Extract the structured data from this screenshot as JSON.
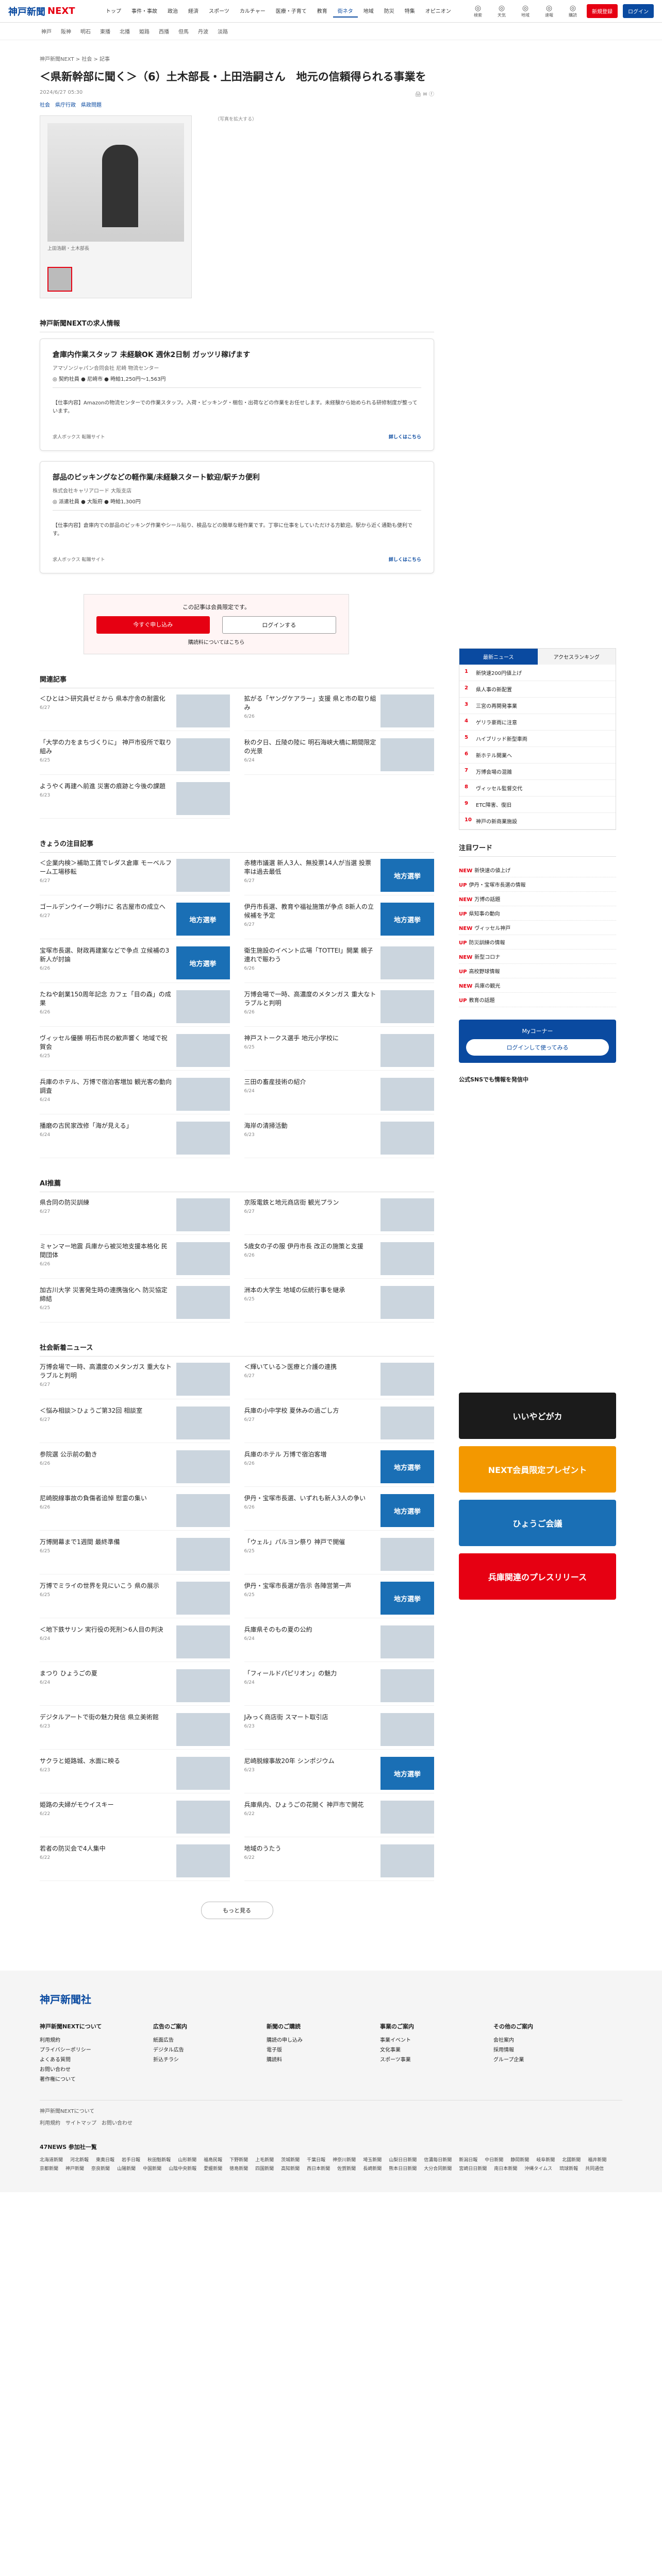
{
  "header": {
    "logo": "神戸新聞",
    "logo_next": "NEXT",
    "nav": [
      "トップ",
      "事件・事故",
      "政治",
      "経済",
      "スポーツ",
      "カルチャー",
      "医療・子育て",
      "教育",
      "街ネタ",
      "地域",
      "防災",
      "特集",
      "オピニオン"
    ],
    "icons": [
      "検索",
      "天気",
      "地域",
      "速報",
      "購読"
    ],
    "register": "新規登録",
    "login": "ログイン"
  },
  "subnav": [
    "神戸",
    "阪神",
    "明石",
    "東播",
    "北播",
    "姫路",
    "西播",
    "但馬",
    "丹波",
    "淡路"
  ],
  "breadcrumb": "神戸新聞NEXT > 社会 > 記事",
  "article": {
    "title": "＜県新幹部に聞く＞（6）土木部長・上田浩嗣さん　地元の信頼得られる事業を",
    "date": "2024/6/27 05:30",
    "tags": "社会　県庁行政　県政問題",
    "caption": "上田浩嗣・土木部長",
    "footnote": "（写真を拡大する）"
  },
  "jobs_head": "神戸新聞NEXTの求人情報",
  "jobs": [
    {
      "title": "倉庫内作業スタッフ 未経験OK 週休2日制 ガッツリ稼げます",
      "company": "アマゾンジャパン合同会社 尼崎 物流センター",
      "detail": "◎ 契約社員 ● 尼崎市 ● 時給1,250円～1,563円",
      "desc": "【仕事内容】Amazonの物流センターでの作業スタッフ。入荷・ピッキング・梱包・出荷などの作業をお任せします。未経験から始められる研修制度が整っています。",
      "source": "求人ボックス 転職サイト",
      "more": "詳しくはこちら"
    },
    {
      "title": "部品のピッキングなどの軽作業/未経験スタート歓迎/駅チカ便利",
      "company": "株式会社キャリアロード 大阪支店",
      "detail": "◎ 派遣社員 ● 大阪府 ● 時給1,300円",
      "desc": "【仕事内容】倉庫内での部品のピッキング作業やシール貼り、検品などの簡単な軽作業です。丁寧に仕事をしていただける方歓迎。駅から近く通勤も便利です。",
      "source": "求人ボックス 転職サイト",
      "more": "詳しくはこちら"
    }
  ],
  "premium": {
    "text": "この記事は会員限定です。",
    "btn1": "今すぐ申し込み",
    "btn2": "ログインする",
    "link": "購読料についてはこちら"
  },
  "related_head": "関連記事",
  "related": [
    {
      "t": "＜ひとは＞研究員ゼミから 県本庁舎の耐震化",
      "m": "6/27"
    },
    {
      "t": "拡がる「ヤングケアラー」支援 県と市の取り組み",
      "m": "6/26"
    },
    {
      "t": "「大学の力をまちづくりに」 神戸市役所で取り組み",
      "m": "6/25"
    },
    {
      "t": "秋の夕日、丘陵の陸に 明石海峡大橋に期間限定の光景",
      "m": "6/24"
    },
    {
      "t": "ようやく再建へ前進 災害の痕跡と今後の課題",
      "m": "6/23"
    }
  ],
  "today_head": "きょうの注目記事",
  "today": [
    {
      "t": "＜企業内検＞補助工賃でレダス倉庫 モーベルフーム工場移転",
      "m": "6/27",
      "b": false
    },
    {
      "t": "赤穂市議選 新人3人、無投票14人が当選 投票率は過去最低",
      "m": "6/27",
      "b": true
    },
    {
      "t": "ゴールデンウイーク明けに 名古屋市の成立へ",
      "m": "6/27",
      "b": true
    },
    {
      "t": "伊丹市長選、教育や福祉施策が争点 8新人の立候補を予定",
      "m": "6/27",
      "b": true
    },
    {
      "t": "宝塚市長選、財政再建案などで争点 立候補の3新人が討論",
      "m": "6/26",
      "b": true
    },
    {
      "t": "衛生施設のイベント広場「TOTTEI」開業 親子連れで賑わう",
      "m": "6/26",
      "b": false
    },
    {
      "t": "たねや創業150周年記念 カフェ「目の森」の成果",
      "m": "6/26",
      "b": false
    },
    {
      "t": "万博会場で一時、高濃度のメタンガス 重大なトラブルと判明",
      "m": "6/26",
      "b": false
    },
    {
      "t": "ヴィッセル優勝 明石市民の歓声響く 地域で祝賀会",
      "m": "6/25",
      "b": false
    },
    {
      "t": "神戸ストークス選手 地元小学校に",
      "m": "6/25",
      "b": false
    },
    {
      "t": "兵庫のホテル、万博で宿泊客増加 観光客の動向調査",
      "m": "6/24",
      "b": false
    },
    {
      "t": "三田の畜産技術の紹介",
      "m": "6/24",
      "b": false
    },
    {
      "t": "播磨の古民家改修「海が見える」",
      "m": "6/24",
      "b": false
    },
    {
      "t": "海岸の清掃活動",
      "m": "6/23",
      "b": false
    }
  ],
  "ai_head": "AI推薦",
  "ai": [
    {
      "t": "県合同の防災訓練",
      "m": "6/27"
    },
    {
      "t": "京阪電鉄と地元商店街 観光プラン",
      "m": "6/27"
    },
    {
      "t": "ミャンマー地震 兵庫から被災地支援本格化 民間団体",
      "m": "6/26"
    },
    {
      "t": "5歳女の子の服 伊丹市長 改正の施策と支援",
      "m": "6/26"
    },
    {
      "t": "加古川大学 災害発生時の連携強化へ 防災協定締結",
      "m": "6/25"
    },
    {
      "t": "洲本の大学生 地域の伝統行事を継承",
      "m": "6/25"
    }
  ],
  "society_head": "社会新着ニュース",
  "society": [
    {
      "t": "万博会場で一時、高濃度のメタンガス 重大なトラブルと判明",
      "m": "6/27",
      "b": false
    },
    {
      "t": "＜輝いている＞医療と介護の連携",
      "m": "6/27",
      "b": false
    },
    {
      "t": "＜悩み相談＞ひょうご第32回 相談室",
      "m": "6/27",
      "b": false
    },
    {
      "t": "兵庫の小中学校 夏休みの過ごし方",
      "m": "6/27",
      "b": false
    },
    {
      "t": "参院選 公示前の動き",
      "m": "6/26",
      "b": false
    },
    {
      "t": "兵庫のホテル 万博で宿泊客増",
      "m": "6/26",
      "b": true
    },
    {
      "t": "尼崎脱線事故の負傷者追悼 慰霊の集い",
      "m": "6/26",
      "b": false
    },
    {
      "t": "伊丹・宝塚市長選、いずれも新人3人の争い",
      "m": "6/26",
      "b": true
    },
    {
      "t": "万博開幕まで1週間 最終準備",
      "m": "6/25",
      "b": false
    },
    {
      "t": "「ウェル」パルヨン祭り 神戸で開催",
      "m": "6/25",
      "b": false
    },
    {
      "t": "万博でミライの世界を見にいこう 県の展示",
      "m": "6/25",
      "b": false
    },
    {
      "t": "伊丹・宝塚市長選が告示 各陣営第一声",
      "m": "6/25",
      "b": true
    },
    {
      "t": "＜地下鉄サリン 実行役の死刑＞6人目の判決",
      "m": "6/24",
      "b": false
    },
    {
      "t": "兵庫県そのもの夏の公約",
      "m": "6/24",
      "b": false
    },
    {
      "t": "まつり ひょうごの夏",
      "m": "6/24",
      "b": false
    },
    {
      "t": "「フィールドパピリオン」の魅力",
      "m": "6/24",
      "b": false
    },
    {
      "t": "デジタルアートで街の魅力発信 県立美術館",
      "m": "6/23",
      "b": false
    },
    {
      "t": "Jみっく商店街 スマート取引店",
      "m": "6/23",
      "b": false
    },
    {
      "t": "サクラと姫路城、水面に映る",
      "m": "6/23",
      "b": false
    },
    {
      "t": "尼崎脱線事故20年 シンポジウム",
      "m": "6/23",
      "b": true
    },
    {
      "t": "姫路の夫婦がモウイスキー",
      "m": "6/22",
      "b": false
    },
    {
      "t": "兵庫県内、ひょうごの花開く 神戸市で開花",
      "m": "6/22",
      "b": false
    },
    {
      "t": "若者の防災会で4人集中",
      "m": "6/22",
      "b": false
    },
    {
      "t": "地域のうたう",
      "m": "6/22",
      "b": false
    }
  ],
  "more": "もっと見る",
  "ranking": {
    "tab1": "最新ニュース",
    "tab2": "アクセスランキング",
    "items": [
      "新快速200円値上げ",
      "県人事の新配置",
      "三宮の再開発事業",
      "ゲリラ豪雨に注意",
      "ハイブリッド新型車両",
      "新ホテル開業へ",
      "万博会場の混雑",
      "ヴィッセル監督交代",
      "ETC障害、復旧",
      "神戸の新商業施設"
    ]
  },
  "keywords_head": "注目ワード",
  "keywords": [
    {
      "tg": "NEW",
      "t": "新快速の値上げ"
    },
    {
      "tg": "UP",
      "t": "伊丹・宝塚市長選の情報"
    },
    {
      "tg": "NEW",
      "t": "万博の話題"
    },
    {
      "tg": "UP",
      "t": "県知事の動向"
    },
    {
      "tg": "NEW",
      "t": "ヴィッセル神戸"
    },
    {
      "tg": "UP",
      "t": "防災訓練の情報"
    },
    {
      "tg": "NEW",
      "t": "新型コロナ"
    },
    {
      "tg": "UP",
      "t": "高校野球情報"
    },
    {
      "tg": "NEW",
      "t": "兵庫の観光"
    },
    {
      "tg": "UP",
      "t": "教育の話題"
    }
  ],
  "mycorner": {
    "title": "Myコーナー",
    "btn": "ログインして使ってみる"
  },
  "sns": "公式SNSでも情報を発信中",
  "banners": [
    "いいやどがカ",
    "NEXT会員限定プレゼント",
    "ひょうご会議",
    "兵庫関連のプレスリリース"
  ],
  "footer": {
    "logo": "神戸新聞社",
    "cols": [
      {
        "h": "神戸新聞NEXTについて",
        "items": [
          "利用規約",
          "プライバシーポリシー",
          "よくある質問",
          "お問い合わせ",
          "著作権について"
        ]
      },
      {
        "h": "広告のご案内",
        "items": [
          "紙面広告",
          "デジタル広告",
          "折込チラシ"
        ]
      },
      {
        "h": "新聞のご購読",
        "items": [
          "購読の申し込み",
          "電子版",
          "購読料"
        ]
      },
      {
        "h": "事業のご案内",
        "items": [
          "事業イベント",
          "文化事業",
          "スポーツ事業"
        ]
      },
      {
        "h": "その他のご案内",
        "items": [
          "会社案内",
          "採用情報",
          "グループ企業"
        ]
      }
    ],
    "bar": "神戸新聞NEXTについて",
    "links": "利用規約　サイトマップ　お問い合わせ",
    "news47": "47NEWS 参加社一覧",
    "members": [
      "北海道新聞",
      "河北新報",
      "東奥日報",
      "岩手日報",
      "秋田魁新報",
      "山形新聞",
      "福島民報",
      "下野新聞",
      "上毛新聞",
      "茨城新聞",
      "千葉日報",
      "神奈川新聞",
      "埼玉新聞",
      "山梨日日新聞",
      "信濃毎日新聞",
      "新潟日報",
      "中日新聞",
      "静岡新聞",
      "岐阜新聞",
      "北國新聞",
      "福井新聞",
      "京都新聞",
      "神戸新聞",
      "奈良新聞",
      "山陽新聞",
      "中国新聞",
      "山陰中央新報",
      "愛媛新聞",
      "徳島新聞",
      "四国新聞",
      "高知新聞",
      "西日本新聞",
      "佐賀新聞",
      "長崎新聞",
      "熊本日日新聞",
      "大分合同新聞",
      "宮崎日日新聞",
      "南日本新聞",
      "沖縄タイムス",
      "琉球新報",
      "共同通信"
    ]
  }
}
